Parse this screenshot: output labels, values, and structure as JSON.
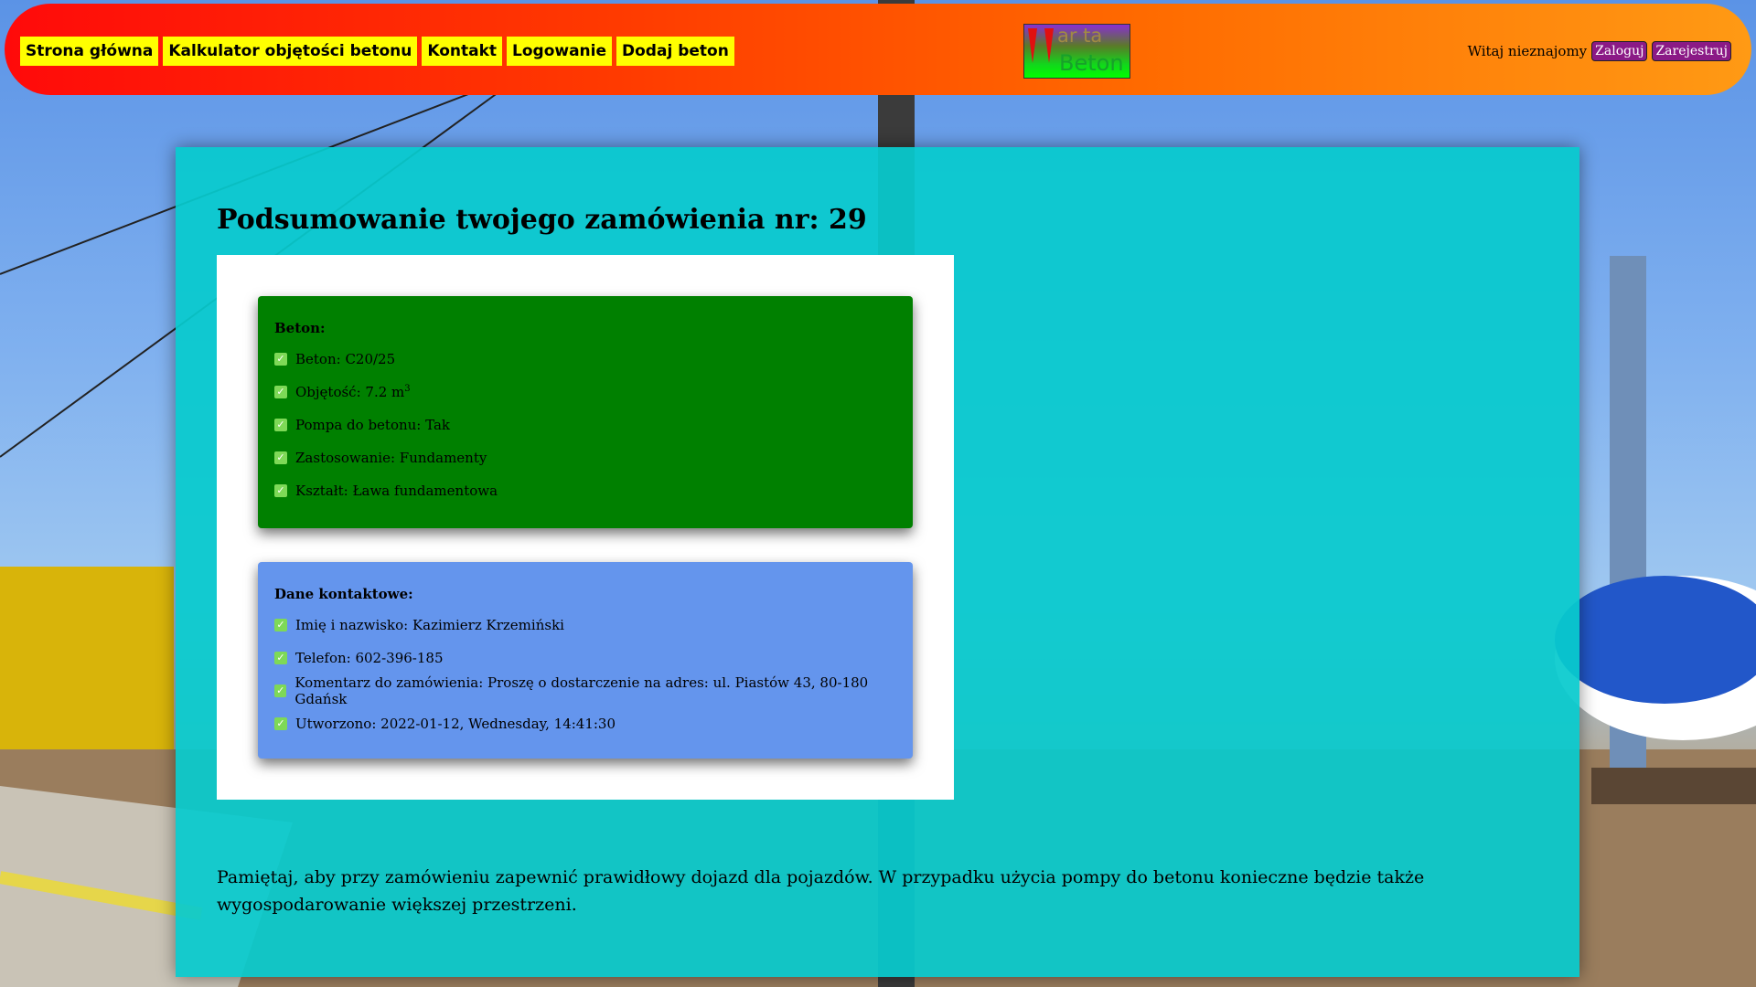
{
  "nav": {
    "links": [
      "Strona główna",
      "Kalkulator objętości betonu",
      "Kontakt",
      "Logowanie",
      "Dodaj beton"
    ]
  },
  "logo": {
    "line1": "ar ta",
    "line2": "Beton"
  },
  "user": {
    "greeting": "Witaj nieznajomy",
    "login_label": "Zaloguj",
    "register_label": "Zarejestruj"
  },
  "summary": {
    "title": "Podsumowanie twojego zamówienia nr: 29",
    "beton": {
      "heading": "Beton:",
      "items": [
        "Beton: C20/25",
        "Objętość: 7.2 m",
        "Pompa do betonu: Tak",
        "Zastosowanie: Fundamenty",
        "Kształt: Ława fundamentowa"
      ],
      "volume_unit_sup": "3"
    },
    "contact": {
      "heading": "Dane kontaktowe:",
      "items": [
        "Imię i nazwisko: Kazimierz Krzemiński",
        "Telefon: 602-396-185",
        "Komentarz do zamówienia: Proszę o dostarczenie na adres: ul. Piastów 43, 80-180 Gdańsk",
        "Utworzono: 2022-01-12, Wednesday, 14:41:30"
      ]
    },
    "note": "Pamiętaj, aby przy zamówieniu zapewnić prawidłowy dojazd dla pojazdów. W przypadku użycia pompy do betonu konieczne będzie także wygospodarowanie większej przestrzeni."
  },
  "colors": {
    "nav_link_bg": "#ffff00",
    "panel_bg": "#08cace",
    "beton_card": "#008000",
    "contact_card": "#6495ed",
    "user_button": "#8b1a86"
  },
  "icons": [
    "check-icon",
    "logo-drop-icon"
  ]
}
